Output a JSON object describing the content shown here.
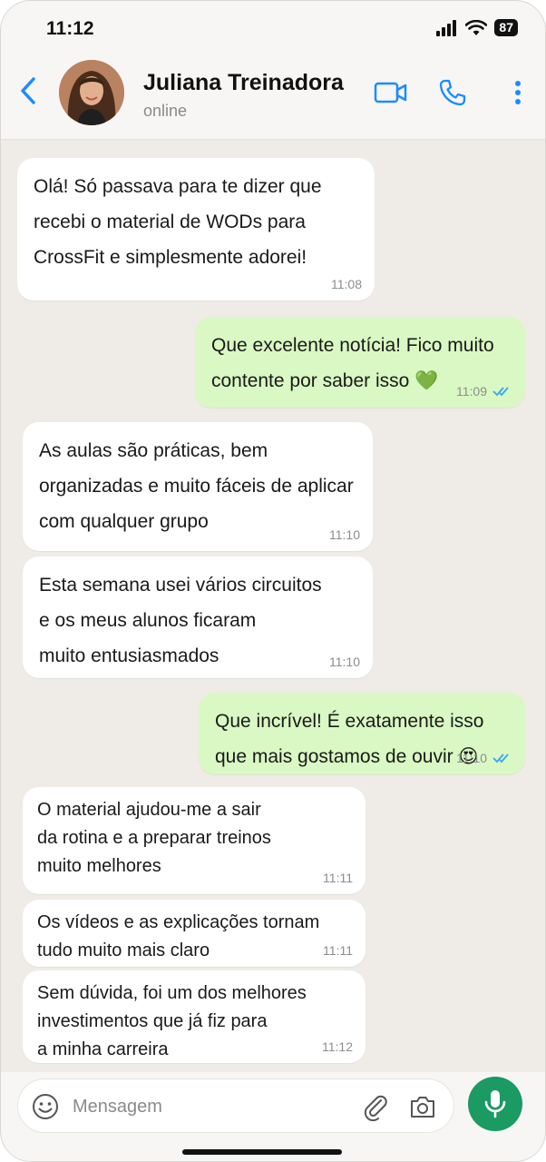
{
  "status_bar": {
    "time": "11:12",
    "battery": "87"
  },
  "header": {
    "name": "Juliana Treinadora",
    "status": "online"
  },
  "messages": [
    {
      "dir": "in",
      "text": "Olá! Só passava para te dizer que\nrecebi o material de WODs para\nCrossFit e simplesmente adorei!",
      "time": "11:08"
    },
    {
      "dir": "out",
      "text": "Que excelente notícia! Fico muito\ncontente por saber isso 💚",
      "time": "11:09"
    },
    {
      "dir": "in",
      "text": "As aulas são práticas, bem\norganizadas e muito fáceis de aplicar\ncom qualquer grupo",
      "time": "11:10"
    },
    {
      "dir": "in",
      "text": "Esta semana usei vários circuitos\ne os meus alunos ficaram\nmuito entusiasmados",
      "time": "11:10"
    },
    {
      "dir": "out",
      "text": "Que incrível! É exatamente isso\nque mais gostamos de ouvir 😍",
      "time": "11:10"
    },
    {
      "dir": "in",
      "text": "O material ajudou-me a sair\nda rotina e a preparar treinos\nmuito melhores",
      "time": "11:11"
    },
    {
      "dir": "in",
      "text": "Os vídeos e as explicações tornam\ntudo muito mais claro",
      "time": "11:11"
    },
    {
      "dir": "in",
      "text": "Sem dúvida, foi um dos melhores\ninvestimentos que já fiz para\na minha carreira",
      "time": "11:12"
    }
  ],
  "input": {
    "placeholder": "Mensagem"
  },
  "colors": {
    "accent": "#1a8cff",
    "outgoing_bubble": "#d9f8c3",
    "mic_button": "#1b9a63",
    "read_ticks": "#34a9f5"
  },
  "icons": {
    "back": "chevron-left-icon",
    "video": "video-camera-icon",
    "call": "phone-icon",
    "menu": "more-vertical-icon",
    "emoji": "emoji-icon",
    "attach": "paperclip-icon",
    "camera": "camera-icon",
    "mic": "microphone-icon",
    "read": "double-check-icon"
  }
}
